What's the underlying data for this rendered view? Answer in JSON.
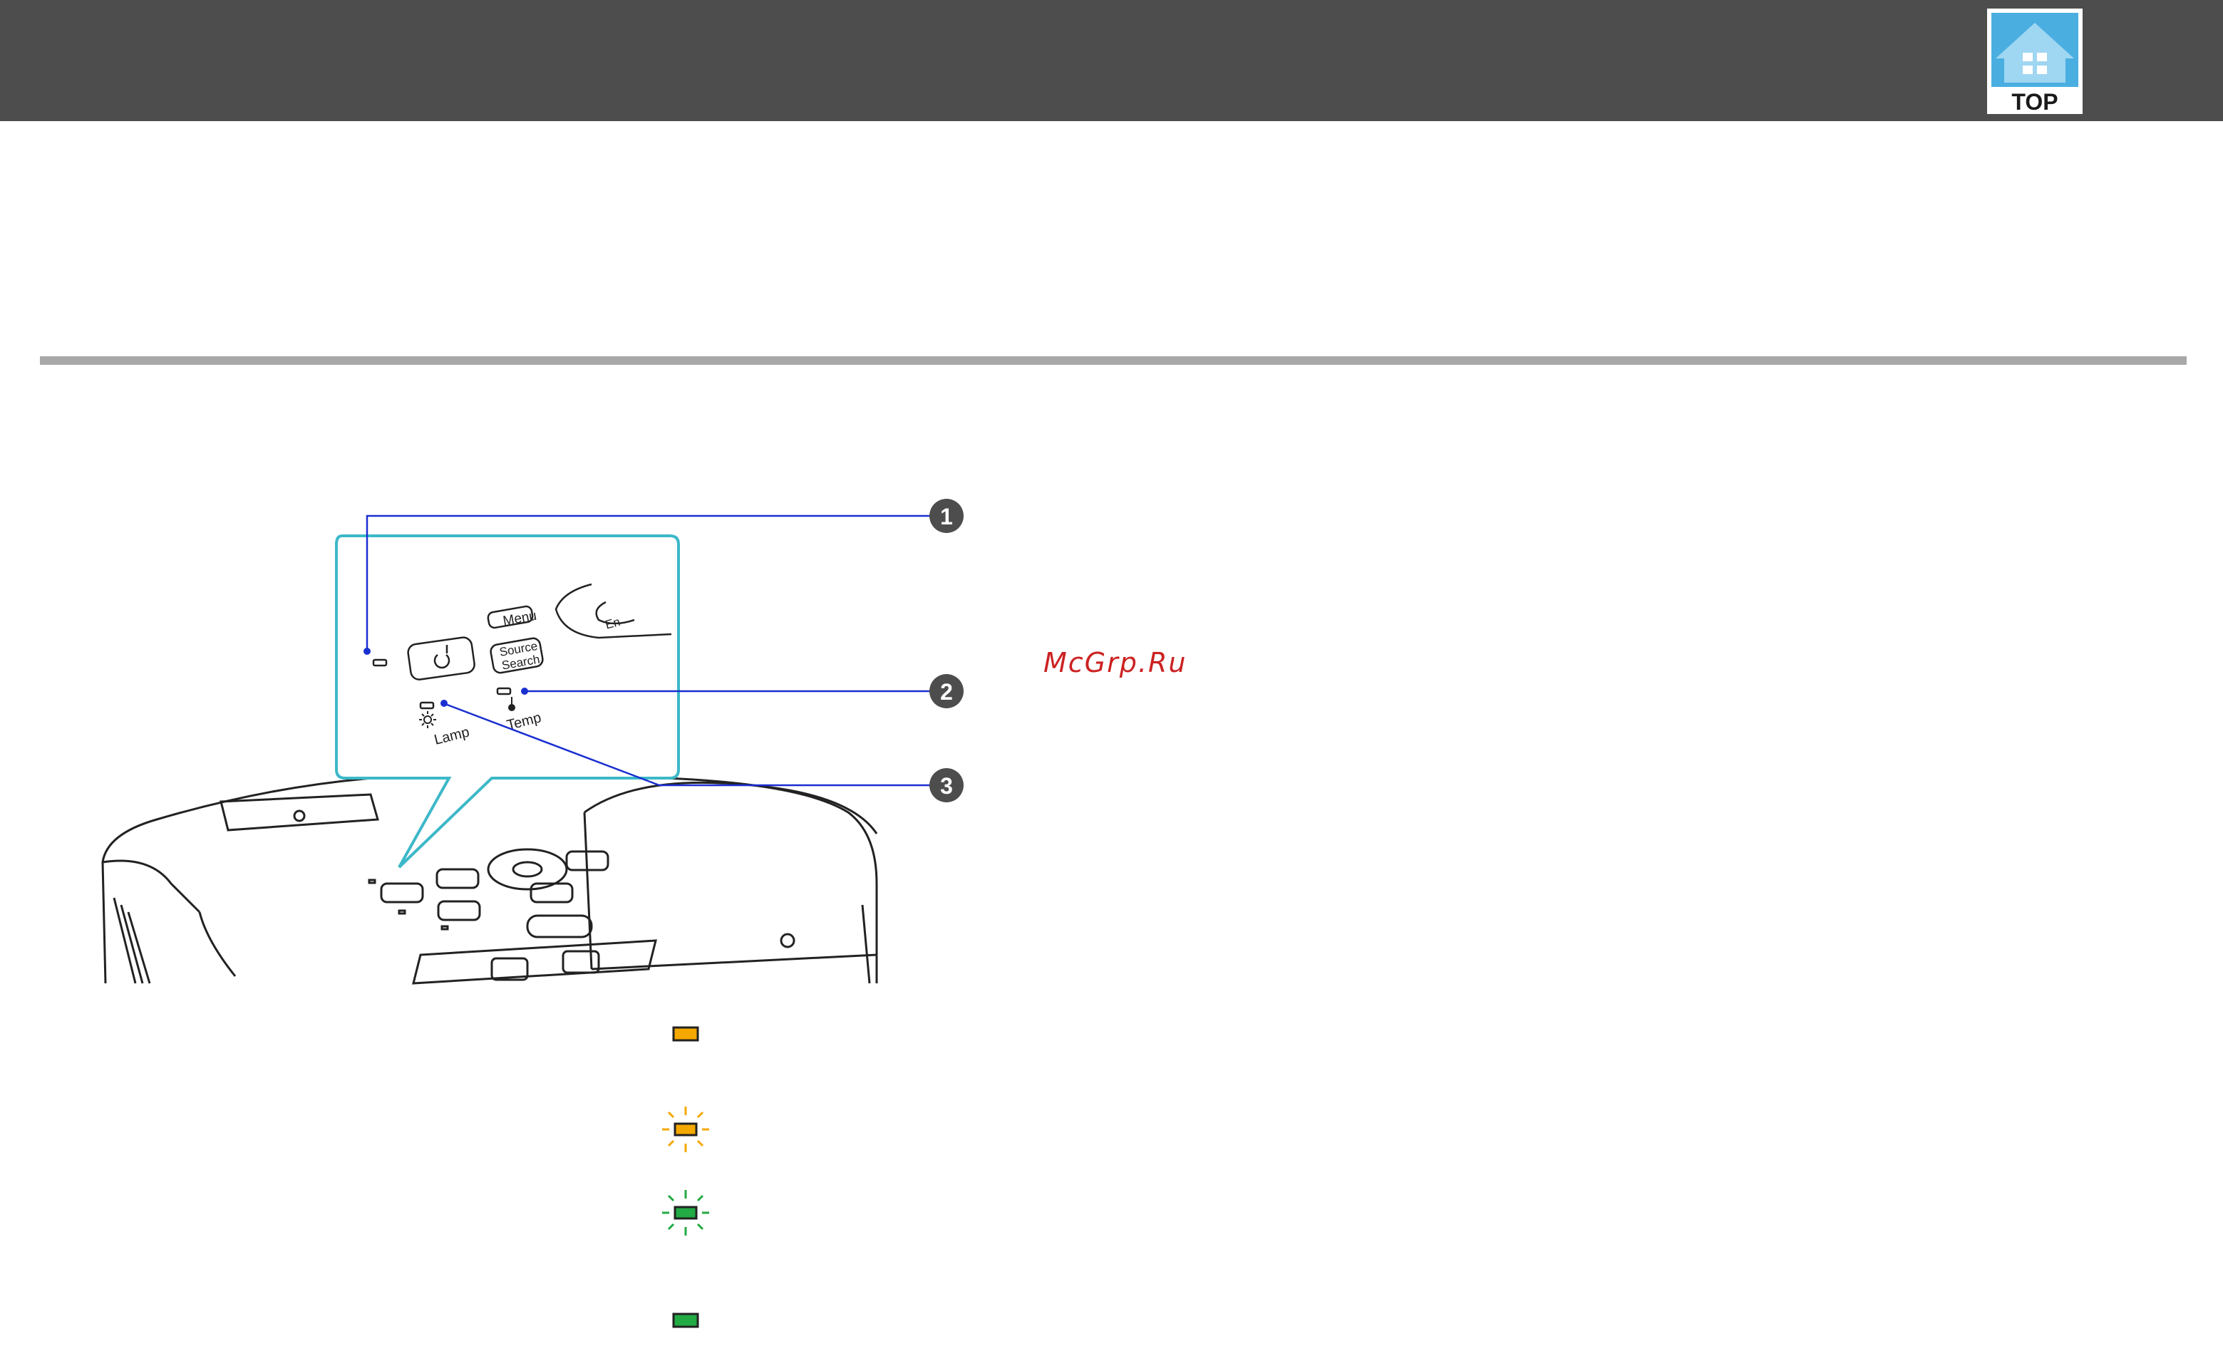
{
  "header": {
    "top_button_label": "TOP",
    "top_button_icon": "house-icon",
    "bar_color": "#4d4d4d"
  },
  "illustration": {
    "panel_labels": {
      "menu": "Menu",
      "source_search_line1": "Source",
      "source_search_line2": "Search",
      "enter_partial": "En",
      "lamp": "Lamp",
      "temp": "Temp"
    },
    "callouts": [
      "1",
      "2",
      "3"
    ],
    "callout_line_color": "#1a2fd0",
    "panel_outline_color": "#3cb8c8"
  },
  "watermark": "McGrp.Ru",
  "indicators": [
    {
      "name": "orange-lit-indicator-icon",
      "state": "lit",
      "color": "#f5a800"
    },
    {
      "name": "orange-flashing-indicator-icon",
      "state": "flashing",
      "color": "#f5a800"
    },
    {
      "name": "green-flashing-indicator-icon",
      "state": "flashing",
      "color": "#22aa44"
    },
    {
      "name": "green-lit-indicator-icon",
      "state": "lit",
      "color": "#22aa44"
    }
  ]
}
